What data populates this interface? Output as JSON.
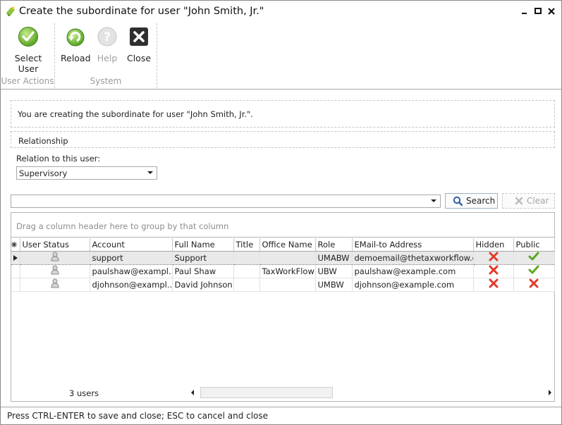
{
  "window": {
    "title": "Create the subordinate for user \"John Smith, Jr.\""
  },
  "ribbon": {
    "groups": [
      {
        "title": "User Actions",
        "buttons": [
          {
            "label_line1": "Select",
            "label_line2": "User",
            "icon": "check-circle-icon",
            "enabled": true
          }
        ]
      },
      {
        "title": "System",
        "buttons": [
          {
            "label": "Reload",
            "icon": "reload-icon",
            "enabled": true
          },
          {
            "label": "Help",
            "icon": "help-icon",
            "enabled": false
          },
          {
            "label": "Close",
            "icon": "close-x-icon",
            "enabled": true
          }
        ]
      }
    ]
  },
  "info": {
    "message": "You are creating the subordinate for user \"John Smith, Jr.\"."
  },
  "relationship": {
    "header": "Relationship",
    "field_label": "Relation to this user:",
    "selected": "Supervisory"
  },
  "search": {
    "value": "",
    "search_label": "Search",
    "clear_label": "Clear"
  },
  "grid": {
    "group_hint": "Drag a column header here to group by that column",
    "columns": [
      "User Status",
      "Account",
      "Full Name",
      "Title",
      "Office Name",
      "Role",
      "EMail-to Address",
      "Hidden",
      "Public"
    ],
    "rows": [
      {
        "account": "support",
        "full_name": "Support",
        "title": "",
        "office": "",
        "role": "UMABW",
        "email": "demoemail@thetaxworkflow.com",
        "hidden": false,
        "public": true
      },
      {
        "account": "paulshaw@exampl...",
        "full_name": "Paul Shaw",
        "title": "",
        "office": "TaxWorkFlow",
        "role": "UBW",
        "email": "paulshaw@example.com",
        "hidden": false,
        "public": true
      },
      {
        "account": "djohnson@exampl...",
        "full_name": "David Johnson",
        "title": "",
        "office": "",
        "role": "UMBW",
        "email": "djohnson@example.com",
        "hidden": false,
        "public": false
      }
    ],
    "footer_count": "3 users"
  },
  "status": {
    "text": "Press CTRL-ENTER to save and close; ESC to cancel and close"
  },
  "colors": {
    "accent_green": "#5aa820",
    "danger_red": "#e23a2c",
    "button_border": "#9fb2c9"
  }
}
